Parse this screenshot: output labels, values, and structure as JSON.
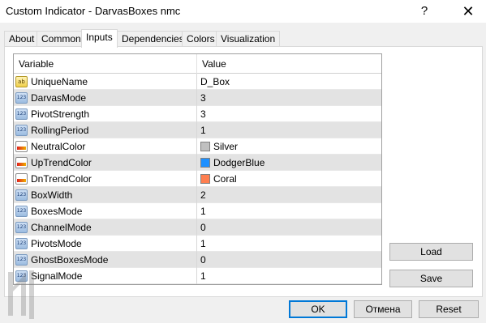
{
  "window": {
    "title": "Custom Indicator - DarvasBoxes nmc",
    "help_label": "?",
    "close_label": "✕"
  },
  "tabs": [
    {
      "label": "About"
    },
    {
      "label": "Common"
    },
    {
      "label": "Inputs"
    },
    {
      "label": "Dependencies"
    },
    {
      "label": "Colors"
    },
    {
      "label": "Visualization"
    }
  ],
  "active_tab": "Inputs",
  "grid": {
    "headers": {
      "variable": "Variable",
      "value": "Value"
    },
    "rows": [
      {
        "name": "UniqueName",
        "value": "D_Box",
        "icon": "string-icon",
        "icon_text": "ab"
      },
      {
        "name": "DarvasMode",
        "value": "3",
        "icon": "integer-icon",
        "icon_text": "123"
      },
      {
        "name": "PivotStrength",
        "value": "3",
        "icon": "integer-icon",
        "icon_text": "123"
      },
      {
        "name": "RollingPeriod",
        "value": "1",
        "icon": "integer-icon",
        "icon_text": "123"
      },
      {
        "name": "NeutralColor",
        "value": "Silver",
        "icon": "color-icon",
        "icon_text": "",
        "color": "#c0c0c0"
      },
      {
        "name": "UpTrendColor",
        "value": "DodgerBlue",
        "icon": "color-icon",
        "icon_text": "",
        "color": "#1e90ff"
      },
      {
        "name": "DnTrendColor",
        "value": "Coral",
        "icon": "color-icon",
        "icon_text": "",
        "color": "#ff7f50"
      },
      {
        "name": "BoxWidth",
        "value": "2",
        "icon": "integer-icon",
        "icon_text": "123"
      },
      {
        "name": "BoxesMode",
        "value": "1",
        "icon": "integer-icon",
        "icon_text": "123"
      },
      {
        "name": "ChannelMode",
        "value": "0",
        "icon": "integer-icon",
        "icon_text": "123"
      },
      {
        "name": "PivotsMode",
        "value": "1",
        "icon": "integer-icon",
        "icon_text": "123"
      },
      {
        "name": "GhostBoxesMode",
        "value": "0",
        "icon": "integer-icon",
        "icon_text": "123"
      },
      {
        "name": "SignalMode",
        "value": "1",
        "icon": "integer-icon",
        "icon_text": "123"
      }
    ]
  },
  "buttons": {
    "load": "Load",
    "save": "Save",
    "ok": "OK",
    "cancel": "Отмена",
    "reset": "Reset"
  },
  "colors": {
    "selection_row": "#e3e3e3",
    "ok_border": "#0078d7"
  }
}
